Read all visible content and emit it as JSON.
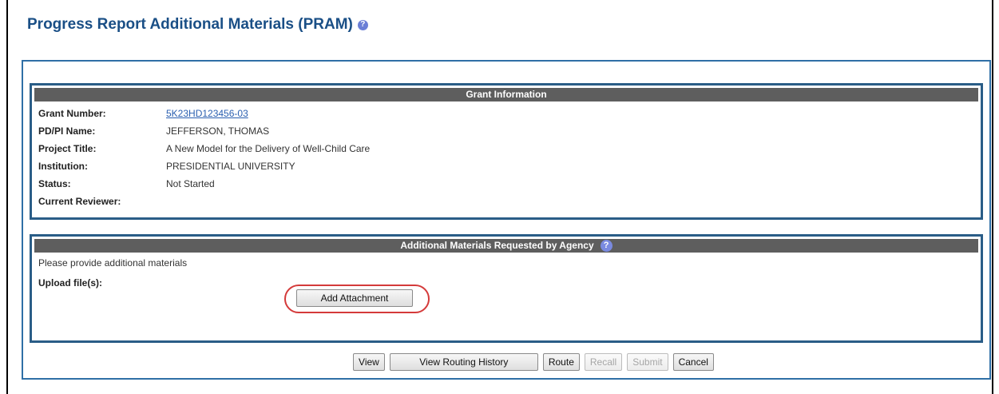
{
  "page": {
    "title": "Progress Report Additional Materials (PRAM)",
    "help_icon": "question-circle-icon"
  },
  "grant_info": {
    "header": "Grant Information",
    "rows": [
      {
        "label": "Grant Number:",
        "value": "5K23HD123456-03",
        "link": true
      },
      {
        "label": "PD/PI Name:",
        "value": "JEFFERSON, THOMAS",
        "link": false
      },
      {
        "label": "Project Title:",
        "value": "A New Model for the Delivery of Well-Child Care",
        "link": false
      },
      {
        "label": "Institution:",
        "value": "PRESIDENTIAL UNIVERSITY",
        "link": false
      },
      {
        "label": "Status:",
        "value": "Not Started",
        "link": false
      },
      {
        "label": "Current Reviewer:",
        "value": "",
        "link": false
      }
    ]
  },
  "additional_materials": {
    "header": "Additional Materials Requested by Agency",
    "help_icon": "question-circle-icon",
    "instruction": "Please provide additional materials",
    "upload_label": "Upload file(s):",
    "add_attachment_label": "Add Attachment"
  },
  "actions": {
    "view": "View",
    "view_routing_history": "View Routing History",
    "route": "Route",
    "recall": "Recall",
    "submit": "Submit",
    "cancel": "Cancel"
  },
  "colors": {
    "title": "#1a4f86",
    "panel_border": "#2a5d87",
    "section_header_bg": "#5e5e5e",
    "highlight_ring": "#d43a3a",
    "link": "#2a5fb0"
  }
}
